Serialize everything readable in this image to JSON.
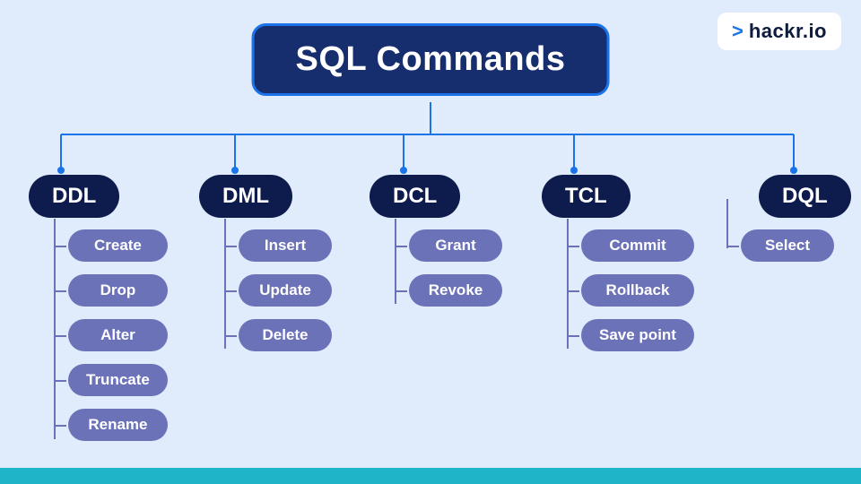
{
  "logo": {
    "prefix": ">",
    "text": "hackr.io"
  },
  "root": {
    "title": "SQL Commands"
  },
  "connector_color": "#1a73e8",
  "categories": [
    {
      "label": "DDL",
      "items": [
        "Create",
        "Drop",
        "Alter",
        "Truncate",
        "Rename"
      ]
    },
    {
      "label": "DML",
      "items": [
        "Insert",
        "Update",
        "Delete"
      ]
    },
    {
      "label": "DCL",
      "items": [
        "Grant",
        "Revoke"
      ]
    },
    {
      "label": "TCL",
      "items": [
        "Commit",
        "Rollback",
        "Save point"
      ]
    },
    {
      "label": "DQL",
      "items": [
        "Select"
      ]
    }
  ]
}
